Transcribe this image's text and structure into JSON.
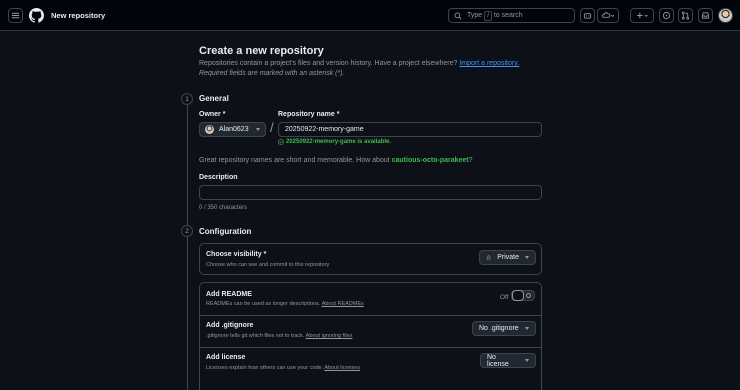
{
  "header": {
    "title": "New repository",
    "search": {
      "prefix": "Type",
      "key": "/",
      "suffix": "to search"
    }
  },
  "page": {
    "heading": "Create a new repository",
    "intro": "Repositories contain a project's files and version history. Have a project elsewhere?",
    "import_link": "Import a repository.",
    "required_note": "Required fields are marked with an asterisk (*)."
  },
  "general": {
    "step": "1",
    "title": "General",
    "owner_label": "Owner *",
    "owner_value": "Alan0623",
    "slash": "/",
    "repo_label": "Repository name *",
    "repo_value": "20250922-memory-game",
    "availability": "20250922-memory-game is available.",
    "suggestion_prefix": "Great repository names are short and memorable. How about",
    "suggestion": "cautious-octo-parakeet",
    "suggestion_suffix": "?",
    "description_label": "Description",
    "description_value": "",
    "char_count": "0 / 350 characters"
  },
  "configuration": {
    "step": "2",
    "title": "Configuration",
    "visibility": {
      "title": "Choose visibility *",
      "desc": "Choose who can see and commit to this repository",
      "value": "Private"
    },
    "readme": {
      "title": "Add README",
      "desc": "READMEs can be used as longer descriptions.",
      "link": "About READMEs",
      "toggle_label": "Off"
    },
    "gitignore": {
      "title": "Add .gitignore",
      "desc": ".gitignore tells git which files not to track.",
      "link": "About ignoring files",
      "value": "No .gitignore"
    },
    "license": {
      "title": "Add license",
      "desc": "Licenses explain how others can use your code.",
      "link": "About licenses",
      "value": "No license"
    }
  }
}
